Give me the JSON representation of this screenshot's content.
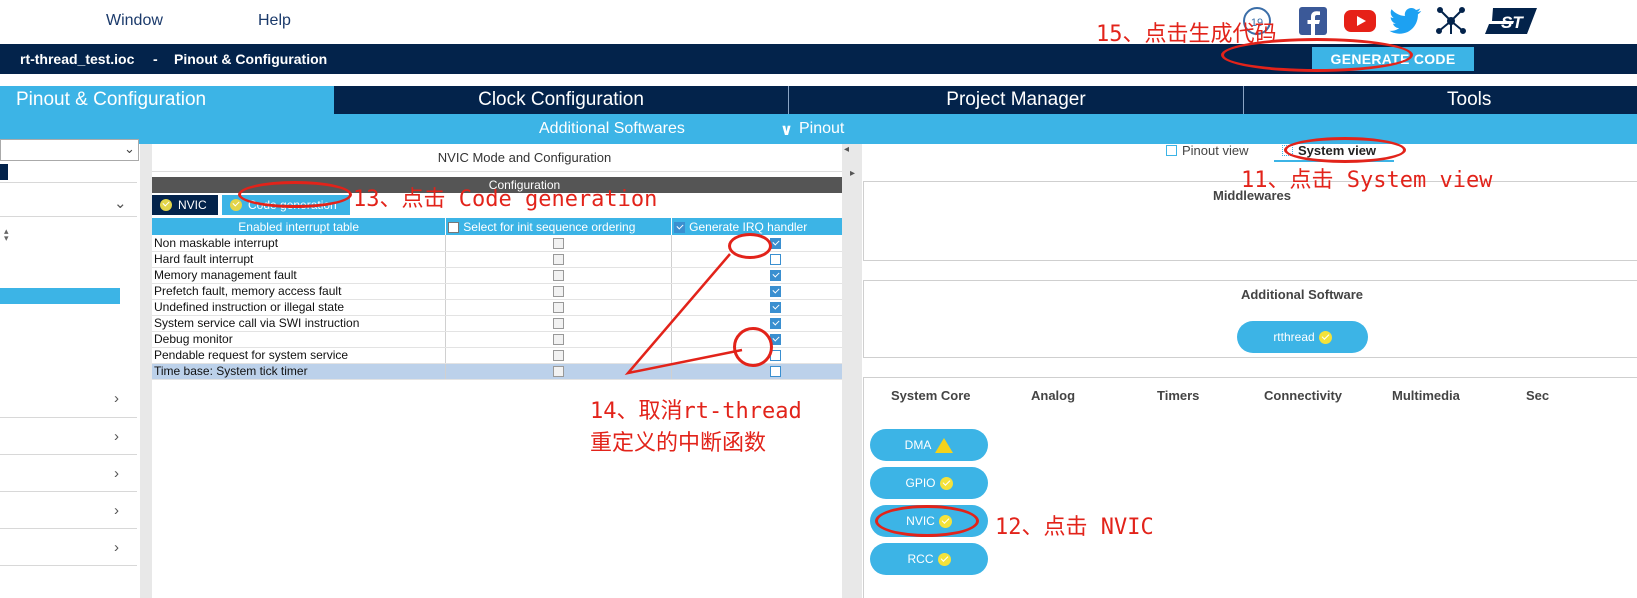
{
  "menu": {
    "window": "Window",
    "help": "Help"
  },
  "social_icons": [
    "anniversary-badge-icon",
    "facebook-icon",
    "youtube-icon",
    "twitter-icon",
    "network-icon",
    "st-logo"
  ],
  "title_bar": {
    "file": "rt-thread_test.ioc",
    "separator": "-",
    "section": "Pinout & Configuration",
    "generate_label": "GENERATE CODE"
  },
  "tabs": [
    "Pinout & Configuration",
    "Clock Configuration",
    "Project Manager",
    "Tools"
  ],
  "subbar": {
    "additional_softwares": "Additional Softwares",
    "pinout": "Pinout",
    "pinout_chevron": "∨"
  },
  "center": {
    "header": "NVIC Mode and Configuration",
    "config_label": "Configuration",
    "subtabs": [
      "NVIC",
      "Code generation"
    ],
    "columns": [
      "Enabled interrupt table",
      "Select for init sequence ordering",
      "Generate IRQ handler"
    ],
    "rows": [
      {
        "name": "Non maskable interrupt",
        "irq": "checked"
      },
      {
        "name": "Hard fault interrupt",
        "irq": "unchecked"
      },
      {
        "name": "Memory management fault",
        "irq": "checked"
      },
      {
        "name": "Prefetch fault, memory access fault",
        "irq": "checked"
      },
      {
        "name": "Undefined instruction or illegal state",
        "irq": "checked"
      },
      {
        "name": "System service call via SWI instruction",
        "irq": "checked"
      },
      {
        "name": "Debug monitor",
        "irq": "checked"
      },
      {
        "name": "Pendable request for system service",
        "irq": "unchecked"
      },
      {
        "name": "Time base: System tick timer",
        "irq": "unchecked"
      }
    ]
  },
  "right": {
    "view_tabs": [
      "Pinout view",
      "System view"
    ],
    "middlewares_title": "Middlewares",
    "additional_software_title": "Additional Software",
    "rtthread_label": "rtthread",
    "categories": [
      "System Core",
      "Analog",
      "Timers",
      "Connectivity",
      "Multimedia",
      "Sec"
    ],
    "system_core_items": [
      "DMA",
      "GPIO",
      "NVIC",
      "RCC"
    ]
  },
  "annotations": {
    "step11": "11、点击 System view",
    "step12": "12、点击 NVIC",
    "step13": "13、点击 Code generation",
    "step14_line1": "14、取消rt-thread",
    "step14_line2": "重定义的中断函数",
    "step15": "15、点击生成代码"
  },
  "colors": {
    "navy": "#03234b",
    "accent": "#3cb4e6",
    "annotation": "#e2231a"
  }
}
